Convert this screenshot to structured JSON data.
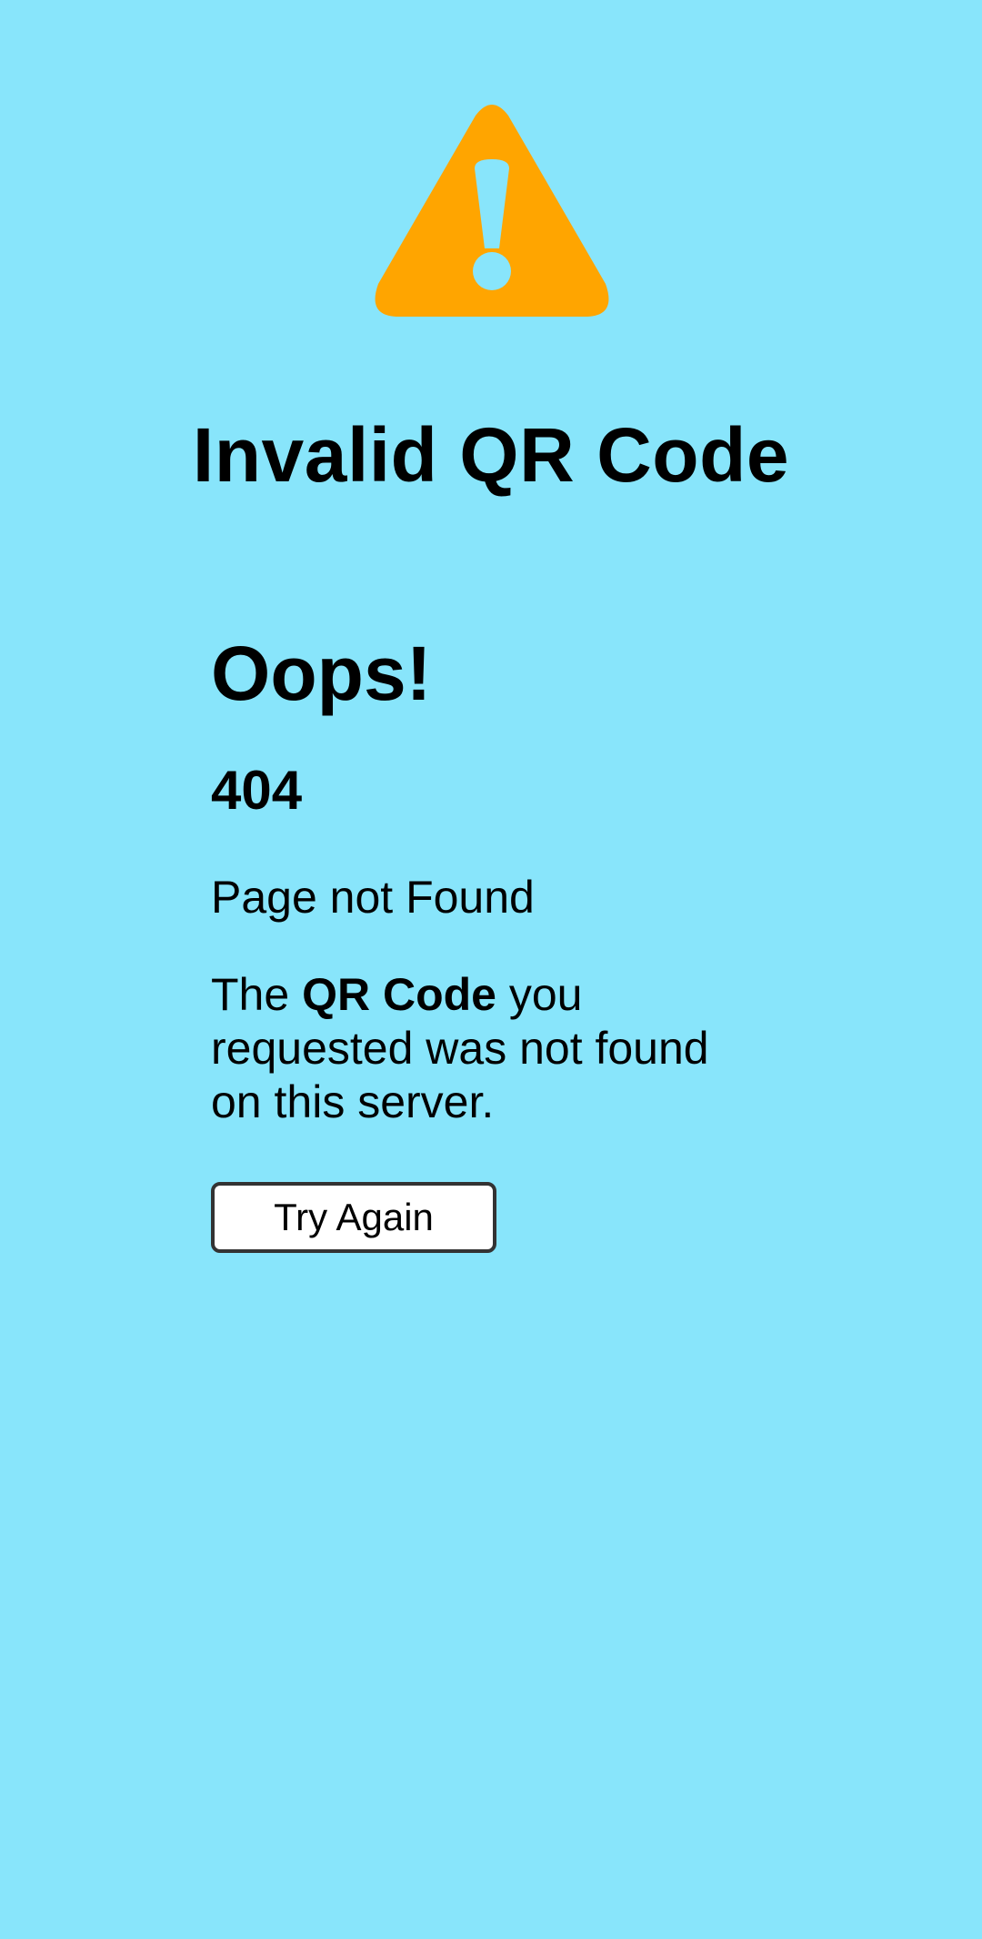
{
  "colors": {
    "background": "#88e5fb",
    "warning": "#ffa500",
    "text": "#000000",
    "button_background": "#ffffff",
    "button_border": "#333333"
  },
  "icon": "warning-triangle-icon",
  "title": "Invalid QR Code",
  "error": {
    "heading": "Oops!",
    "code": "404",
    "subtitle": "Page not Found",
    "message_prefix": "The ",
    "message_bold": "QR Code",
    "message_suffix": " you requested was not found on this server."
  },
  "button": {
    "label": "Try Again"
  }
}
